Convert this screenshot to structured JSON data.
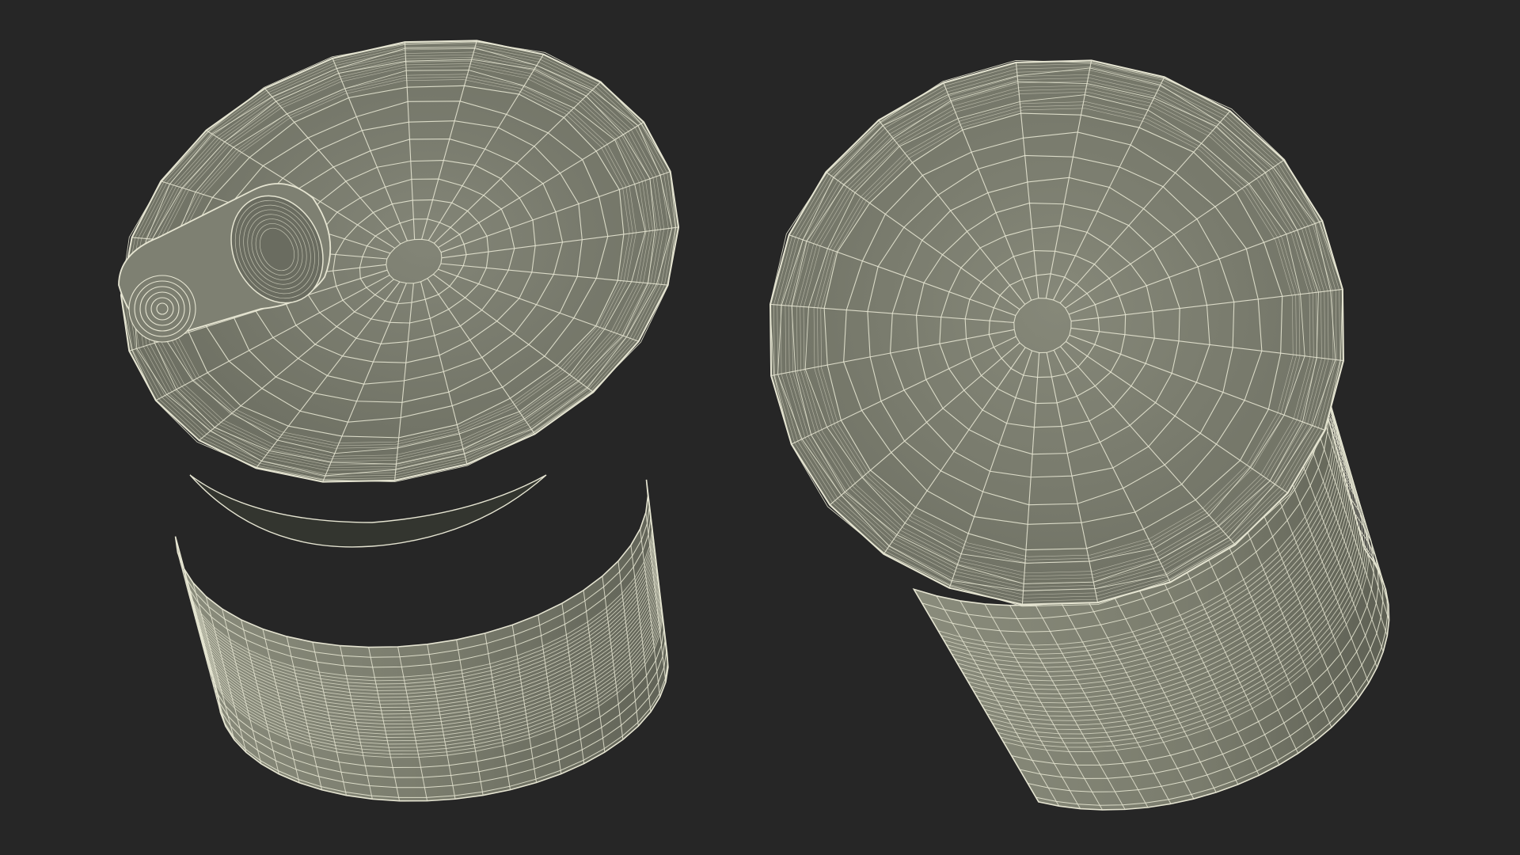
{
  "scene": {
    "subject": "wireframe-cans",
    "colors": {
      "background": "#262626",
      "mesh_fill": "#7a7c6d",
      "mesh_fill_light": "#8d8f80",
      "mesh_fill_dark": "#5f6155",
      "wire": "#e6e5d2",
      "interior": "#33352f"
    },
    "objects": [
      {
        "name": "open-can",
        "state": "lid-open-with-pull-tab"
      },
      {
        "name": "closed-can",
        "state": "lid-closed"
      }
    ]
  }
}
